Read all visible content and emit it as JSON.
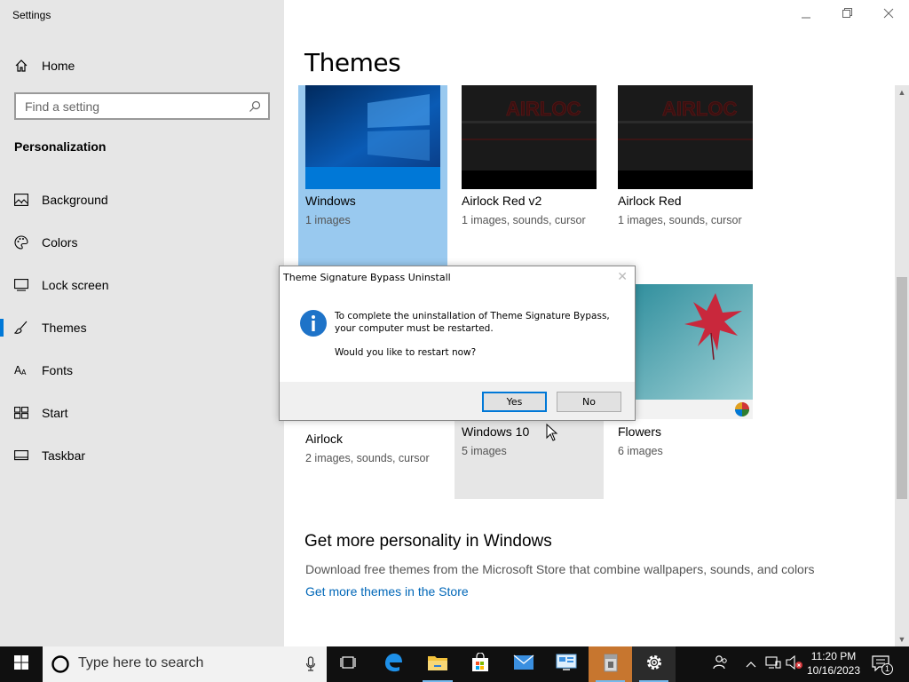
{
  "app": {
    "title": "Settings"
  },
  "sidebar": {
    "home_label": "Home",
    "search_placeholder": "Find a setting",
    "section_title": "Personalization",
    "items": [
      {
        "label": "Background",
        "icon": "picture-icon"
      },
      {
        "label": "Colors",
        "icon": "palette-icon"
      },
      {
        "label": "Lock screen",
        "icon": "monitor-lock-icon"
      },
      {
        "label": "Themes",
        "icon": "brush-icon",
        "active": true
      },
      {
        "label": "Fonts",
        "icon": "font-icon"
      },
      {
        "label": "Start",
        "icon": "start-grid-icon"
      },
      {
        "label": "Taskbar",
        "icon": "taskbar-icon"
      }
    ]
  },
  "main": {
    "title": "Themes",
    "themes": [
      {
        "name": "Windows",
        "meta": "1 images",
        "selected": true
      },
      {
        "name": "Airlock Red v2",
        "meta": "1 images, sounds, cursor"
      },
      {
        "name": "Airlock Red",
        "meta": "1 images, sounds, cursor"
      },
      {
        "name": "Airlock",
        "meta": "2 images, sounds, cursor"
      },
      {
        "name": "Windows 10",
        "meta": "5 images",
        "hovered": true
      },
      {
        "name": "Flowers",
        "meta": "6 images"
      }
    ],
    "more_title": "Get more personality in Windows",
    "more_desc": "Download free themes from the Microsoft Store that combine wallpapers, sounds, and colors",
    "store_link": "Get more themes in the Store"
  },
  "dialog": {
    "title": "Theme Signature Bypass Uninstall",
    "message": "To complete the uninstallation of Theme Signature Bypass, your computer must be restarted.",
    "question": "Would you like to restart now?",
    "yes_label": "Yes",
    "no_label": "No"
  },
  "taskbar": {
    "search_placeholder": "Type here to search",
    "time": "11:20 PM",
    "date": "10/16/2023",
    "notification_count": "1"
  },
  "colors": {
    "accent": "#0078d7",
    "selected_theme_bg": "#99c9ef",
    "link": "#0067b8"
  }
}
